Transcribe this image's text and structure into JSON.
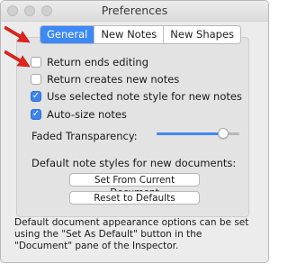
{
  "window": {
    "title": "Preferences"
  },
  "tabs": [
    "General",
    "New Notes",
    "New Shapes"
  ],
  "active_tab": "General",
  "options": [
    {
      "label": "Return ends editing",
      "checked": false
    },
    {
      "label": "Return creates new notes",
      "checked": false
    },
    {
      "label": "Use selected note style for new notes",
      "checked": true
    },
    {
      "label": "Auto-size notes",
      "checked": true
    }
  ],
  "faded_transparency": {
    "label": "Faded Transparency:",
    "value_fraction": 0.8
  },
  "default_styles": {
    "heading": "Default note styles for new documents:",
    "set_from_current": "Set From Current Document",
    "reset_defaults": "Reset to Defaults"
  },
  "footer_text": "Default document appearance options can be set using the \"Set As Default\" button in the \"Document\" pane of the Inspector.",
  "colors": {
    "accent": "#3d89f5",
    "annotation_arrow": "#e0241c"
  }
}
